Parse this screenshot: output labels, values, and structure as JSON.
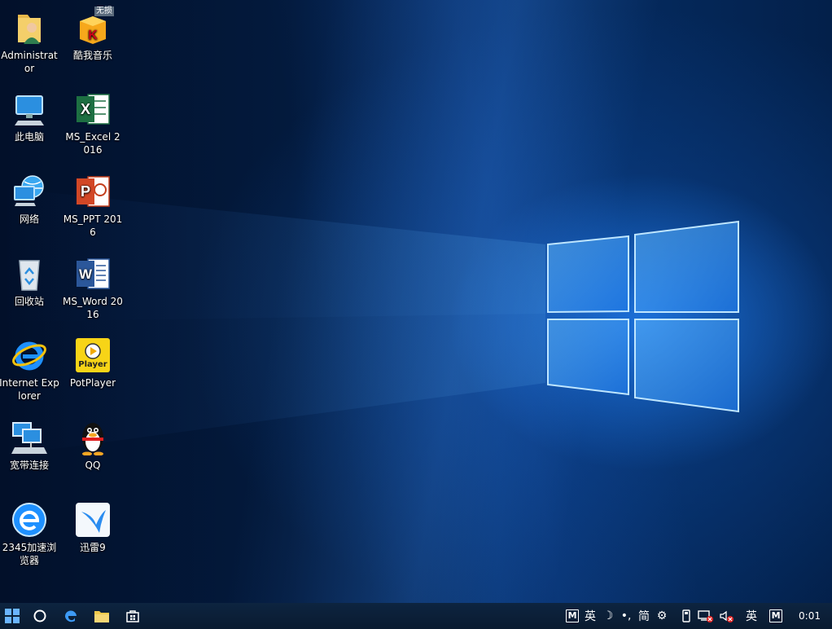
{
  "desktop_icons": [
    {
      "id": "administrator",
      "label": "Administrator",
      "icon": "user-folder-icon"
    },
    {
      "id": "kuwo",
      "label": "酷我音乐",
      "icon": "kuwo-music-icon",
      "badge": "无损"
    },
    {
      "id": "this-pc",
      "label": "此电脑",
      "icon": "computer-icon"
    },
    {
      "id": "excel",
      "label": "MS_Excel 2016",
      "icon": "excel-icon"
    },
    {
      "id": "network",
      "label": "网络",
      "icon": "network-icon"
    },
    {
      "id": "ppt",
      "label": "MS_PPT 2016",
      "icon": "powerpoint-icon"
    },
    {
      "id": "recycle",
      "label": "回收站",
      "icon": "recycle-bin-icon"
    },
    {
      "id": "word",
      "label": "MS_Word 2016",
      "icon": "word-icon"
    },
    {
      "id": "ie",
      "label": "Internet Explorer",
      "icon": "internet-explorer-icon"
    },
    {
      "id": "potplayer",
      "label": "PotPlayer",
      "icon": "potplayer-icon",
      "badge": "Player"
    },
    {
      "id": "broadband",
      "label": "宽带连接",
      "icon": "broadband-icon"
    },
    {
      "id": "qq",
      "label": "QQ",
      "icon": "qq-penguin-icon"
    },
    {
      "id": "browser2345",
      "label": "2345加速浏览器",
      "icon": "browser-2345-icon"
    },
    {
      "id": "xunlei",
      "label": "迅雷9",
      "icon": "xunlei-icon"
    }
  ],
  "taskbar": {
    "buttons": [
      "start-icon",
      "cortana-search-icon",
      "edge-icon",
      "file-explorer-icon",
      "store-icon"
    ],
    "tray": {
      "ime_m": "M",
      "ime_lang": "英",
      "ime_moon": "☽",
      "ime_punct": "•,",
      "ime_simplified": "简",
      "ime_gear": "⚙",
      "lang_indicator": "英",
      "m_indicator": "M",
      "clock": "0:01"
    }
  }
}
